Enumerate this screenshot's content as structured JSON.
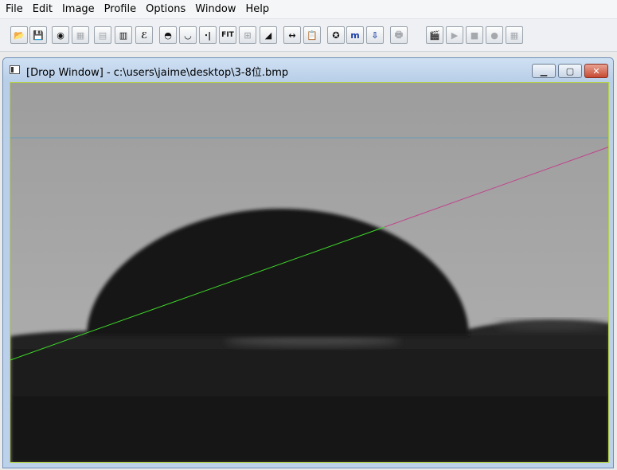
{
  "menubar": {
    "items": [
      "File",
      "Edit",
      "Image",
      "Profile",
      "Options",
      "Window",
      "Help"
    ]
  },
  "toolbar": {
    "buttons": [
      {
        "name": "open-button",
        "icon": "open-file-icon",
        "glyph": "📂",
        "enabled": true
      },
      {
        "name": "save-button",
        "icon": "save-file-icon",
        "glyph": "💾",
        "enabled": true
      },
      {
        "name": "drop-profile-button",
        "icon": "drop-icon",
        "glyph": "◉",
        "enabled": true
      },
      {
        "name": "image-button",
        "icon": "image-icon",
        "glyph": "▦",
        "enabled": false
      },
      {
        "name": "table-button",
        "icon": "table-icon",
        "glyph": "▤",
        "enabled": false
      },
      {
        "name": "chart-button",
        "icon": "bar-chart-icon",
        "glyph": "▥",
        "enabled": true
      },
      {
        "name": "epsilon-button",
        "icon": "epsilon-icon",
        "glyph": "ℰ",
        "enabled": true
      },
      {
        "name": "sessile-drop-button",
        "icon": "sessile-drop-icon",
        "glyph": "◓",
        "enabled": true
      },
      {
        "name": "pendant-drop-button",
        "icon": "pendant-drop-icon",
        "glyph": "◡",
        "enabled": true
      },
      {
        "name": "needle-button",
        "icon": "needle-icon",
        "glyph": "⋅|",
        "enabled": true
      },
      {
        "name": "fit-button",
        "icon": "fit-icon",
        "glyph": "FIT",
        "enabled": true
      },
      {
        "name": "grid-button",
        "icon": "grid-icon",
        "glyph": "⊞",
        "enabled": false
      },
      {
        "name": "contact-angle-button",
        "icon": "contact-angle-icon",
        "glyph": "◢",
        "enabled": true
      },
      {
        "name": "width-button",
        "icon": "width-arrows-icon",
        "glyph": "↔",
        "enabled": true
      },
      {
        "name": "clipboard-button",
        "icon": "clipboard-icon",
        "glyph": "📋",
        "enabled": false
      },
      {
        "name": "dial-button",
        "icon": "dial-icon",
        "glyph": "✪",
        "enabled": true
      },
      {
        "name": "m-button",
        "icon": "m-icon",
        "glyph": "m",
        "enabled": true,
        "blue": true
      },
      {
        "name": "syringe-button",
        "icon": "syringe-icon",
        "glyph": "⇩",
        "enabled": true,
        "blue": true
      },
      {
        "name": "print-button",
        "icon": "printer-icon",
        "glyph": "🖶",
        "enabled": false
      },
      {
        "name": "video-button",
        "icon": "clapperboard-icon",
        "glyph": "🎬",
        "enabled": true
      },
      {
        "name": "play-button",
        "icon": "play-icon",
        "glyph": "▶",
        "enabled": false
      },
      {
        "name": "stop-button",
        "icon": "stop-icon",
        "glyph": "■",
        "enabled": false
      },
      {
        "name": "record-button",
        "icon": "record-icon",
        "glyph": "●",
        "enabled": false
      },
      {
        "name": "frames-button",
        "icon": "frames-grid-icon",
        "glyph": "▦",
        "enabled": false
      }
    ]
  },
  "window": {
    "title": "[Drop Window] - c:\\users\\jaime\\desktop\\3-8位.bmp",
    "controls": {
      "minimize": "▁",
      "maximize": "▢",
      "close": "✕"
    }
  },
  "overlay_colors": {
    "baseline": "#6b9bb8",
    "tangent_left": "#3fdc2a",
    "tangent_right": "#c0448c",
    "frame": "#b4d04a"
  }
}
